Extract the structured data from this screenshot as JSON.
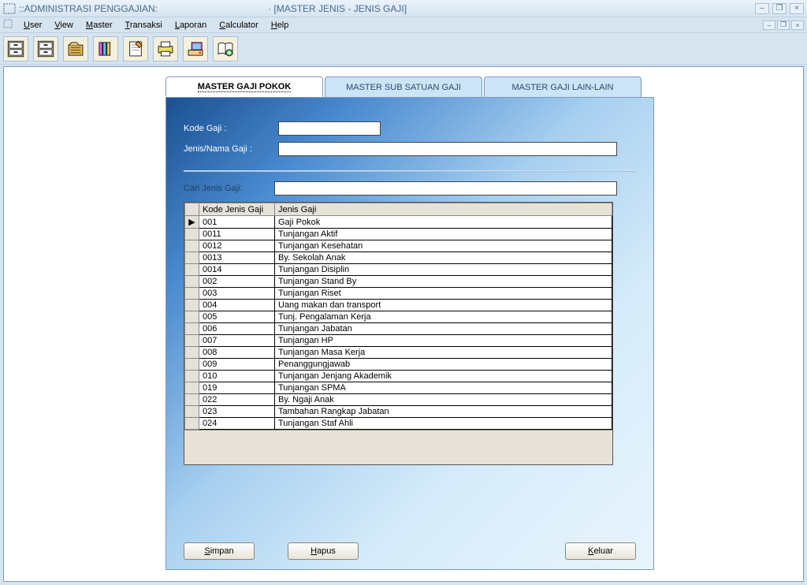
{
  "window": {
    "app_title": "::ADMINISTRASI PENGGAJIAN:",
    "child_title": "· [MASTER JENIS - JENIS GAJI]"
  },
  "menus": {
    "user": "User",
    "view": "View",
    "master": "Master",
    "transaksi": "Transaksi",
    "laporan": "Laporan",
    "calculator": "Calculator",
    "help": "Help"
  },
  "tabs": {
    "tab1": "MASTER GAJI POKOK",
    "tab2": "MASTER SUB SATUAN GAJI",
    "tab3": "MASTER GAJI LAIN-LAIN"
  },
  "form": {
    "kode_label": "Kode Gaji :",
    "kode_value": "",
    "nama_label": "Jenis/Nama Gaji :",
    "nama_value": "",
    "search_label": "Cari Jenis Gaji:",
    "search_value": ""
  },
  "grid": {
    "col_code": "Kode Jenis Gaji",
    "col_name": "Jenis Gaji",
    "rows": [
      {
        "code": "001",
        "name": "Gaji Pokok"
      },
      {
        "code": "0011",
        "name": "Tunjangan Aktif"
      },
      {
        "code": "0012",
        "name": "Tunjangan Kesehatan"
      },
      {
        "code": "0013",
        "name": "By. Sekolah Anak"
      },
      {
        "code": "0014",
        "name": "Tunjangan Disiplin"
      },
      {
        "code": "002",
        "name": "Tunjangan Stand By"
      },
      {
        "code": "003",
        "name": "Tunjangan Riset"
      },
      {
        "code": "004",
        "name": "Uang makan dan transport"
      },
      {
        "code": "005",
        "name": "Tunj. Pengalaman Kerja"
      },
      {
        "code": "006",
        "name": "Tunjangan Jabatan"
      },
      {
        "code": "007",
        "name": "Tunjangan HP"
      },
      {
        "code": "008",
        "name": "Tunjangan Masa Kerja"
      },
      {
        "code": "009",
        "name": "Penanggungjawab"
      },
      {
        "code": "010",
        "name": "Tunjangan Jenjang Akademik"
      },
      {
        "code": "019",
        "name": "Tunjangan SPMA"
      },
      {
        "code": "022",
        "name": "By. Ngaji Anak"
      },
      {
        "code": "023",
        "name": "Tambahan Rangkap Jabatan"
      },
      {
        "code": "024",
        "name": "Tunjangan Staf Ahli"
      }
    ]
  },
  "buttons": {
    "simpan": "Simpan",
    "hapus": "Hapus",
    "keluar": "Keluar"
  }
}
